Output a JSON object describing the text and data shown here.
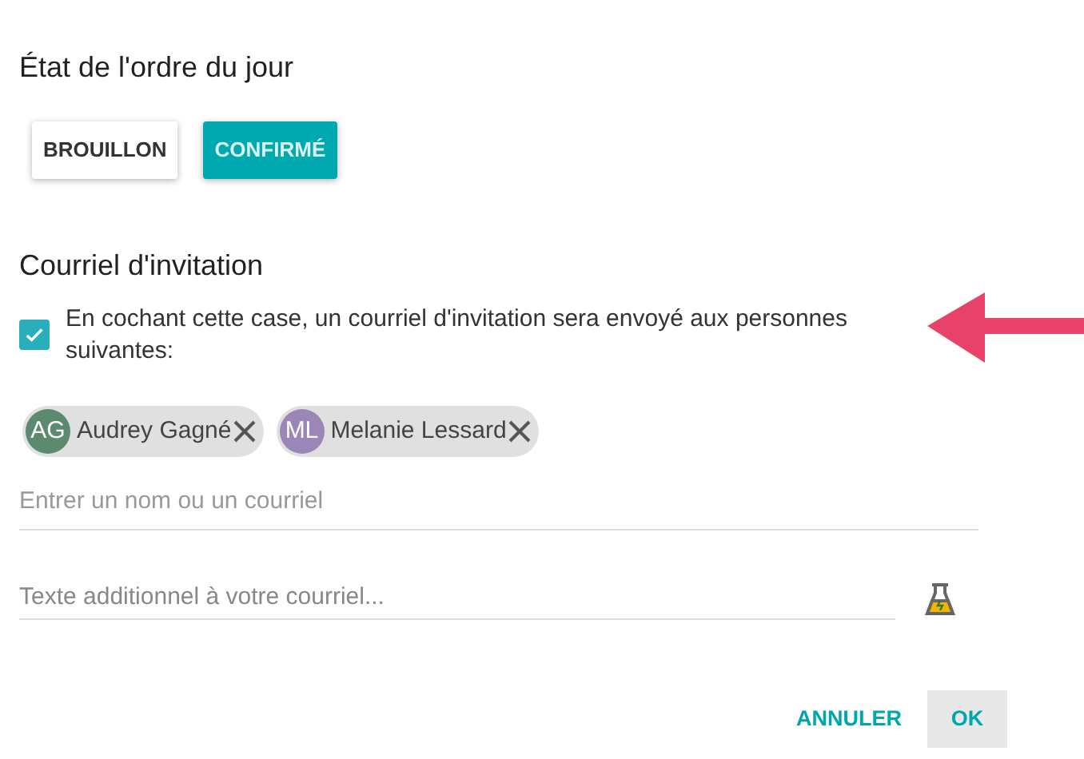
{
  "agenda_status": {
    "title": "État de l'ordre du jour",
    "options": [
      {
        "label": "BROUILLON",
        "selected": false
      },
      {
        "label": "CONFIRMÉ",
        "selected": true
      }
    ]
  },
  "invitation": {
    "title": "Courriel d'invitation",
    "checkbox": {
      "label": "En cochant cette case, un courriel d'invitation sera envoyé aux personnes suivantes:",
      "checked": true
    },
    "recipients": [
      {
        "initials": "AG",
        "name": "Audrey Gagné",
        "color": "#5b8a6e"
      },
      {
        "initials": "ML",
        "name": "Melanie Lessard",
        "color": "#9b86b8"
      }
    ],
    "recipient_field": {
      "placeholder": "Entrer un nom ou un courriel"
    },
    "message_field": {
      "placeholder": "Texte additionnel à votre courriel..."
    }
  },
  "actions": [
    {
      "label": "ANNULER",
      "kind": "text"
    },
    {
      "label": "OK",
      "kind": "filled"
    }
  ]
}
